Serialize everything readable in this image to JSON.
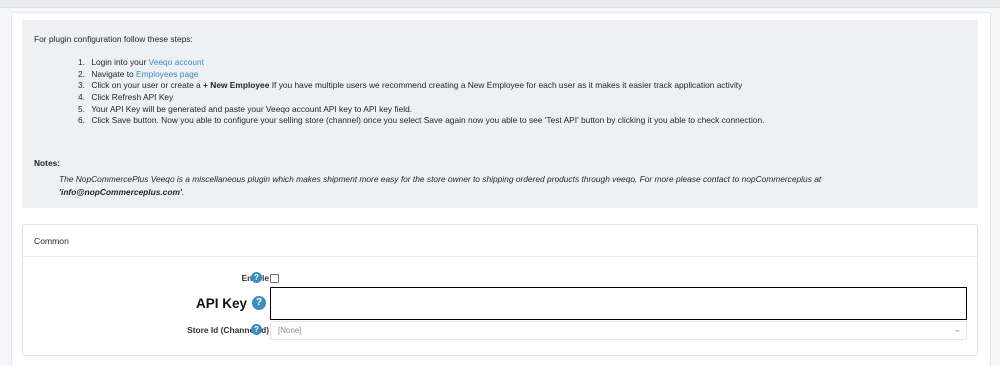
{
  "instructions": {
    "intro": "For plugin configuration follow these steps:",
    "steps": [
      {
        "num": "1.",
        "before": "Login into your ",
        "link": "Veeqo account",
        "after": ""
      },
      {
        "num": "2.",
        "before": "Navigate to ",
        "link": "Employees page",
        "after": ""
      },
      {
        "num": "3.",
        "before": "Click on your user or create a ",
        "strong": "+ New Employee",
        "after": " If you have multiple users we recommend creating a New Employee for each user as it makes it easier track application activity"
      },
      {
        "num": "4.",
        "before": "Click Refresh API Key",
        "after": ""
      },
      {
        "num": "5.",
        "before": "Your API Key will be generated and paste your Veeqo account API key to API key field.",
        "after": ""
      },
      {
        "num": "6.",
        "before": "Click Save button. Now you able to configure your selling store (channel) once you select Save again now you able to see 'Test API' button by clicking it you able to check connection.",
        "after": ""
      }
    ],
    "notes_title": "Notes:",
    "notes_text": "The NopCommercePlus Veeqo is a miscellaneous plugin which makes shipment more easy for the store owner to shipping ordered products through veeqo. For more please contact to nopCommerceplus at",
    "notes_email": "'info@nopCommerceplus.com'",
    "notes_end": "."
  },
  "common": {
    "header": "Common",
    "enable_label": "Enable",
    "api_key_label": "API Key",
    "api_key_value": "",
    "store_id_label": "Store Id (Channel Id)",
    "store_id_selected": "[None]"
  },
  "icons": {
    "help": "question-circle-icon",
    "dropdown": "chevron-down-icon"
  },
  "colors": {
    "link": "#3c8dbc",
    "help_icon": "#3c8dbc",
    "info_background": "#eef0f3"
  }
}
